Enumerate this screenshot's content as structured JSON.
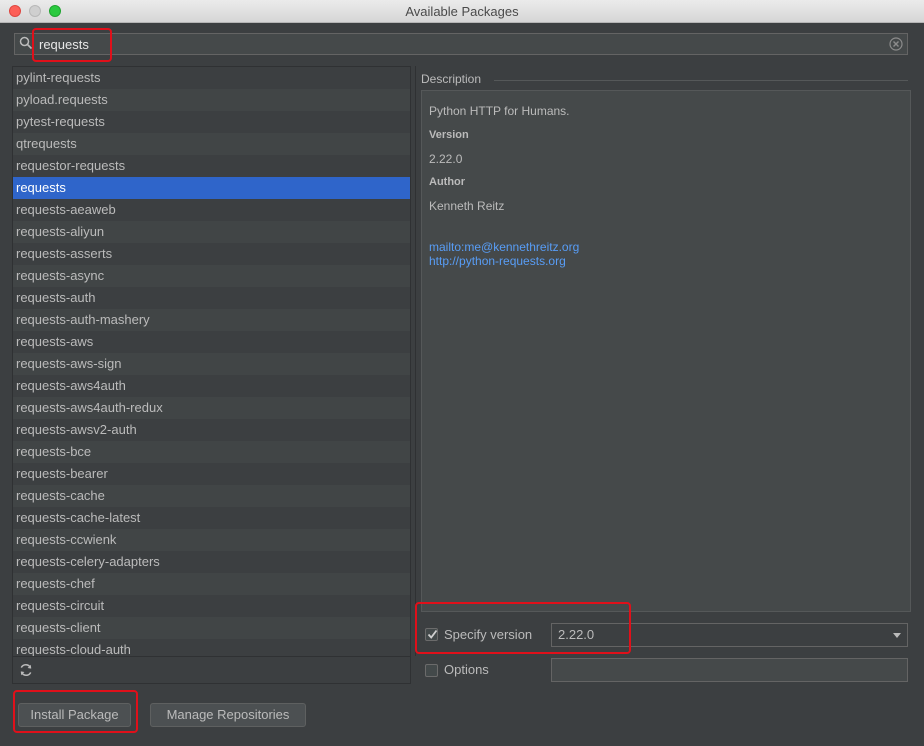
{
  "window": {
    "title": "Available Packages"
  },
  "search": {
    "value": "requests"
  },
  "packages": [
    "pylint-requests",
    "pyload.requests",
    "pytest-requests",
    "qtrequests",
    "requestor-requests",
    "requests",
    "requests-aeaweb",
    "requests-aliyun",
    "requests-asserts",
    "requests-async",
    "requests-auth",
    "requests-auth-mashery",
    "requests-aws",
    "requests-aws-sign",
    "requests-aws4auth",
    "requests-aws4auth-redux",
    "requests-awsv2-auth",
    "requests-bce",
    "requests-bearer",
    "requests-cache",
    "requests-cache-latest",
    "requests-ccwienk",
    "requests-celery-adapters",
    "requests-chef",
    "requests-circuit",
    "requests-client",
    "requests-cloud-auth"
  ],
  "selected_package": "requests",
  "description": {
    "label": "Description",
    "summary": "Python HTTP for Humans.",
    "version_heading": "Version",
    "version": "2.22.0",
    "author_heading": "Author",
    "author": "Kenneth Reitz",
    "links": [
      "mailto:me@kennethreitz.org",
      "http://python-requests.org"
    ]
  },
  "specify_version": {
    "label": "Specify version",
    "checked": true,
    "value": "2.22.0"
  },
  "options": {
    "label": "Options",
    "checked": false,
    "value": ""
  },
  "buttons": {
    "install": "Install Package",
    "manage": "Manage Repositories"
  },
  "icons": {
    "search": "search-icon",
    "clear": "clear-icon",
    "refresh": "refresh-icon",
    "check": "checkmark-icon"
  }
}
